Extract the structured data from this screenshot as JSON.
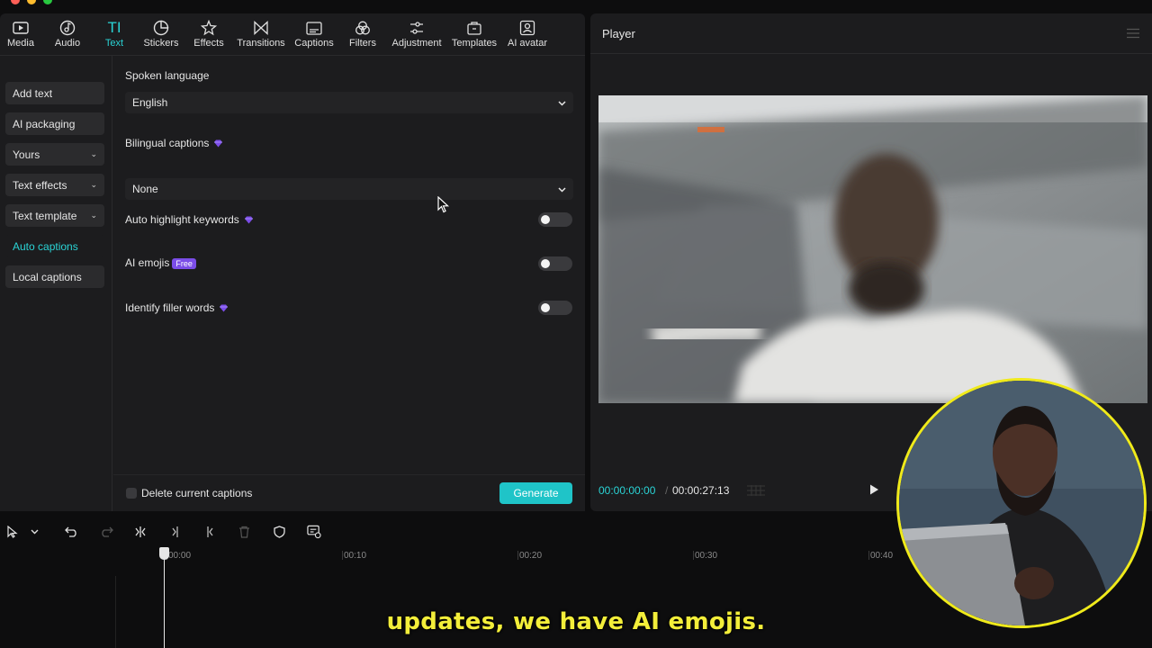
{
  "toolbar": {
    "tabs": [
      {
        "label": "Media",
        "icon": "media-icon"
      },
      {
        "label": "Audio",
        "icon": "audio-icon"
      },
      {
        "label": "Text",
        "icon": "text-icon",
        "active": true
      },
      {
        "label": "Stickers",
        "icon": "stickers-icon"
      },
      {
        "label": "Effects",
        "icon": "effects-icon"
      },
      {
        "label": "Transitions",
        "icon": "transitions-icon"
      },
      {
        "label": "Captions",
        "icon": "captions-icon"
      },
      {
        "label": "Filters",
        "icon": "filters-icon"
      },
      {
        "label": "Adjustment",
        "icon": "adjustment-icon"
      },
      {
        "label": "Templates",
        "icon": "templates-icon"
      },
      {
        "label": "AI avatar",
        "icon": "ai-avatar-icon"
      }
    ]
  },
  "sidebar": {
    "items": [
      {
        "label": "Add text",
        "expandable": false
      },
      {
        "label": "AI packaging",
        "expandable": false
      },
      {
        "label": "Yours",
        "expandable": true
      },
      {
        "label": "Text effects",
        "expandable": true
      },
      {
        "label": "Text template",
        "expandable": true
      },
      {
        "label": "Auto captions",
        "expandable": false,
        "active": true
      },
      {
        "label": "Local captions",
        "expandable": false
      }
    ]
  },
  "captions": {
    "spoken_language_label": "Spoken language",
    "spoken_language_value": "English",
    "bilingual_label": "Bilingual captions",
    "bilingual_value": "None",
    "highlight_label": "Auto highlight keywords",
    "emojis_label": "AI emojis",
    "emojis_badge": "Free",
    "filler_label": "Identify filler words",
    "delete_label": "Delete current captions",
    "generate_label": "Generate",
    "toggles": {
      "highlight": false,
      "emojis": false,
      "filler": false
    }
  },
  "player": {
    "title": "Player",
    "current_time": "00:00:00:00",
    "total_time": "00:00:27:13"
  },
  "timeline": {
    "ticks": [
      "00:00",
      "00:10",
      "00:20",
      "00:30",
      "00:40"
    ]
  },
  "subtitle": "updates, we have AI emojis.",
  "colors": {
    "accent": "#2ad4d6",
    "generate": "#1fc4c8",
    "premium": "#7b4de8",
    "subtitle": "#f3ee3a"
  }
}
